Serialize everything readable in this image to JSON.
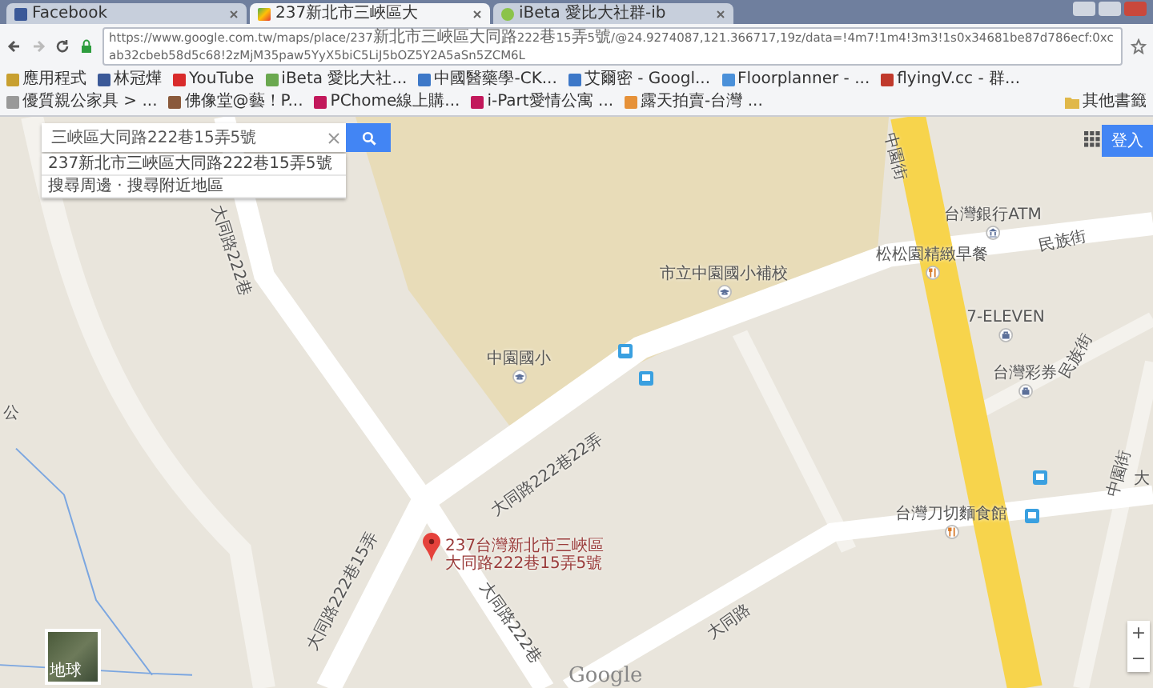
{
  "browser": {
    "tabs": [
      {
        "title": "Facebook",
        "kind": "facebook",
        "selected": false
      },
      {
        "title": "237新北市三峽區大",
        "kind": "maps",
        "selected": true
      },
      {
        "title": "iBeta 愛比大社群-ib",
        "kind": "site",
        "selected": false
      }
    ],
    "url": "https://www.google.com.tw/maps/place/237新北市三峽區大同路222巷15弄5號/@24.9274087,121.366717,19z/data=!4m7!1m4!3m3!1s0x34681be87d786ecf:0xcab32cbeb58d5c68!2zMjM35paw5YyX5biC5LiJ5bOZ5Y2A5aSn5ZCM6L",
    "bookmarks": [
      {
        "label": "應用程式"
      },
      {
        "label": "林冠燁"
      },
      {
        "label": "YouTube"
      },
      {
        "label": "iBeta 愛比大社..."
      },
      {
        "label": "中國醫藥學-CK..."
      },
      {
        "label": "艾爾密 - Googl..."
      },
      {
        "label": "Floorplanner - ..."
      },
      {
        "label": "flyingV.cc - 群..."
      },
      {
        "label": "優質親公家具 > ..."
      },
      {
        "label": "佛像堂@藝！P..."
      },
      {
        "label": "PChome線上購..."
      },
      {
        "label": "i-Part愛情公寓 ..."
      },
      {
        "label": "露天拍賣-台灣 ..."
      }
    ],
    "other_bookmarks": "其他書籤"
  },
  "map": {
    "search": {
      "value": "三峽區大同路222巷15弄5號"
    },
    "suggestions": [
      "237新北市三峽區大同路222巷15弄5號",
      "搜尋周邊 · 搜尋附近地區"
    ],
    "sign_in": "登入",
    "labels": [
      {
        "text": "中園街",
        "kind": "street"
      },
      {
        "text": "台灣銀行ATM",
        "kind": "bank"
      },
      {
        "text": "松松園精緻早餐",
        "kind": "restaurant"
      },
      {
        "text": "市立中園國小補校",
        "kind": "school"
      },
      {
        "text": "民族街",
        "kind": "street"
      },
      {
        "text": "7-ELEVEN",
        "kind": "shop"
      },
      {
        "text": "台灣彩券",
        "kind": "shop"
      },
      {
        "text": "民族街",
        "kind": "street"
      },
      {
        "text": "中園國小",
        "kind": "school"
      },
      {
        "text": "大同路222巷22弄",
        "kind": "street"
      },
      {
        "text": "中園街",
        "kind": "street"
      },
      {
        "text": "大",
        "kind": "street"
      },
      {
        "text": "台灣刀切麵食館",
        "kind": "restaurant"
      },
      {
        "text": "大同路",
        "kind": "street"
      },
      {
        "text": "大同路222巷",
        "kind": "street"
      },
      {
        "text": "大同路222巷15弄",
        "kind": "street"
      },
      {
        "text": "大同路222巷",
        "kind": "street"
      },
      {
        "text": "公",
        "kind": "street"
      }
    ],
    "marker_label": "237台灣新北市三峽區大同路222巷15弄5號",
    "logo": "Google",
    "earth_label": "地球",
    "zoom": [
      "+",
      "−"
    ]
  }
}
